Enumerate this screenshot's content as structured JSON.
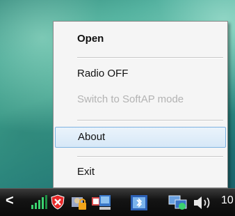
{
  "menu": {
    "items": [
      {
        "label": "Open"
      },
      {
        "label": "Radio OFF"
      },
      {
        "label": "Switch to SoftAP mode"
      },
      {
        "label": "About"
      },
      {
        "label": "Exit"
      }
    ]
  },
  "taskbar": {
    "arrow": "<",
    "clock": "10",
    "icons": [
      "signal-bars-icon",
      "security-shield-icon",
      "user-lock-icon",
      "network-adapter-icon",
      "bluetooth-icon",
      "network-computer-icon",
      "volume-icon"
    ]
  },
  "colors": {
    "menu_bg": "#f5f5f5",
    "highlight_border": "#7db2e0",
    "disabled_text": "#b3b3b3"
  }
}
